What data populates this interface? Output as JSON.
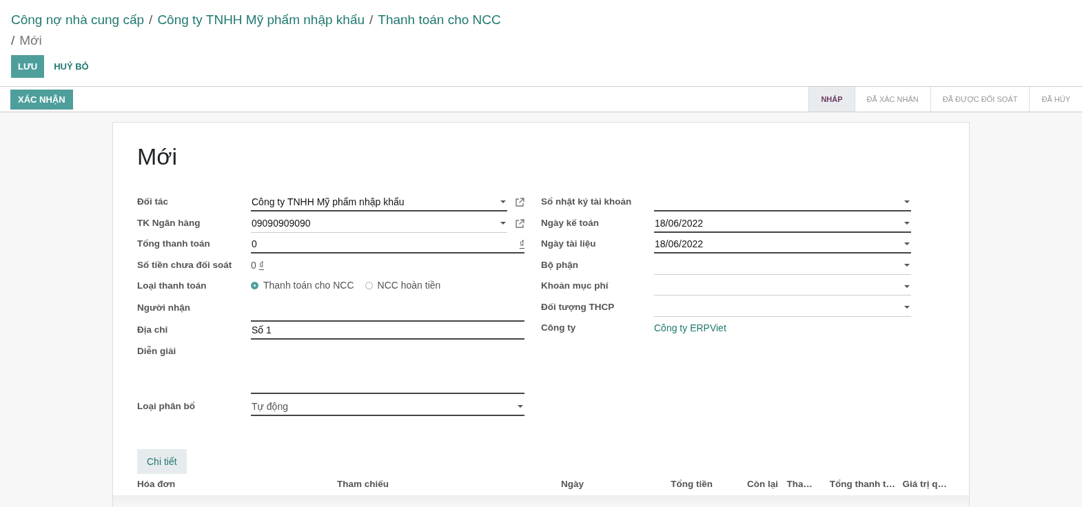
{
  "breadcrumb": [
    {
      "label": "Công nợ nhà cung cấp",
      "current": false
    },
    {
      "separator": "/",
      "label": "Công ty TNHH Mỹ phẩm nhập khẩu",
      "current": false
    },
    {
      "separator": "/",
      "label": "Thanh toán cho NCC",
      "current": false
    },
    {
      "separator": "/",
      "label": "Mới",
      "current": true
    }
  ],
  "buttons": [
    {
      "label": "LƯU",
      "kind": "primary"
    },
    {
      "label": "HUỶ BỎ",
      "kind": "secondary"
    }
  ],
  "action_button": "XÁC NHẬN",
  "status_steps": [
    {
      "label": "NHÁP",
      "selected": true
    },
    {
      "label": "ĐÃ XÁC NHẬN",
      "selected": false
    },
    {
      "label": "ĐÃ ĐƯỢC ĐỐI SOÁT",
      "selected": false
    },
    {
      "label": "ĐÃ HỦY",
      "selected": false
    }
  ],
  "form": {
    "title": "Mới",
    "left_fields": [
      {
        "label": "Đối tác",
        "kind": "select",
        "value": "Công ty TNHH Mỹ phẩm nhập khẩu",
        "required": true,
        "external_link": true
      },
      {
        "label": "TK Ngân hàng",
        "kind": "select",
        "value": "09090909090",
        "required": false,
        "external_link": true
      },
      {
        "label": "Tổng thanh toán",
        "kind": "monetary",
        "value": "0",
        "currency": "₫",
        "required": true
      },
      {
        "label": "Số tiền chưa đối soát",
        "kind": "readonly",
        "value": "0",
        "currency": "₫"
      },
      {
        "label": "Loại thanh toán",
        "kind": "radio",
        "options": [
          {
            "label": "Thanh toán cho NCC",
            "selected": true
          },
          {
            "label": "NCC hoàn tiền",
            "selected": false
          }
        ]
      },
      {
        "label": "Người nhận",
        "kind": "text",
        "required": true
      },
      {
        "label": "Địa chỉ",
        "kind": "text",
        "value": "Số 1",
        "required": true
      },
      {
        "label": "Diễn giải",
        "kind": "textarea",
        "required": true
      },
      {
        "label": "Loại phân bổ",
        "kind": "select",
        "value": "Tự động",
        "required": true,
        "muted": true
      }
    ],
    "right_fields": [
      {
        "label": "Sổ nhật ký tài khoản",
        "kind": "select",
        "required": true
      },
      {
        "label": "Ngày kế toán",
        "kind": "select",
        "value": "18/06/2022",
        "required": true
      },
      {
        "label": "Ngày tài liệu",
        "kind": "select",
        "value": "18/06/2022",
        "required": true
      },
      {
        "label": "Bộ phận",
        "kind": "select",
        "required": false
      },
      {
        "label": "Khoản mục phí",
        "kind": "select",
        "required": false
      },
      {
        "label": "Đối tượng THCP",
        "kind": "select",
        "required": false
      },
      {
        "label": "Công ty",
        "kind": "link",
        "value": "Công ty ERPViet"
      }
    ],
    "tabs": [
      {
        "label": "Chi tiết",
        "selected": true
      }
    ],
    "table": {
      "columns": [
        {
          "label": "Hóa đơn",
          "kind": "text"
        },
        {
          "label": "Tham chiếu",
          "kind": "text"
        },
        {
          "label": "Ngày",
          "kind": "text"
        },
        {
          "label": "Tổng tiền",
          "kind": "number"
        },
        {
          "label": "Còn lại",
          "kind": "number"
        },
        {
          "label": "Tha…",
          "kind": "number"
        },
        {
          "label": "Tổng thanh t…",
          "kind": "number"
        },
        {
          "label": "Giá trị q…",
          "kind": "number"
        }
      ]
    }
  }
}
